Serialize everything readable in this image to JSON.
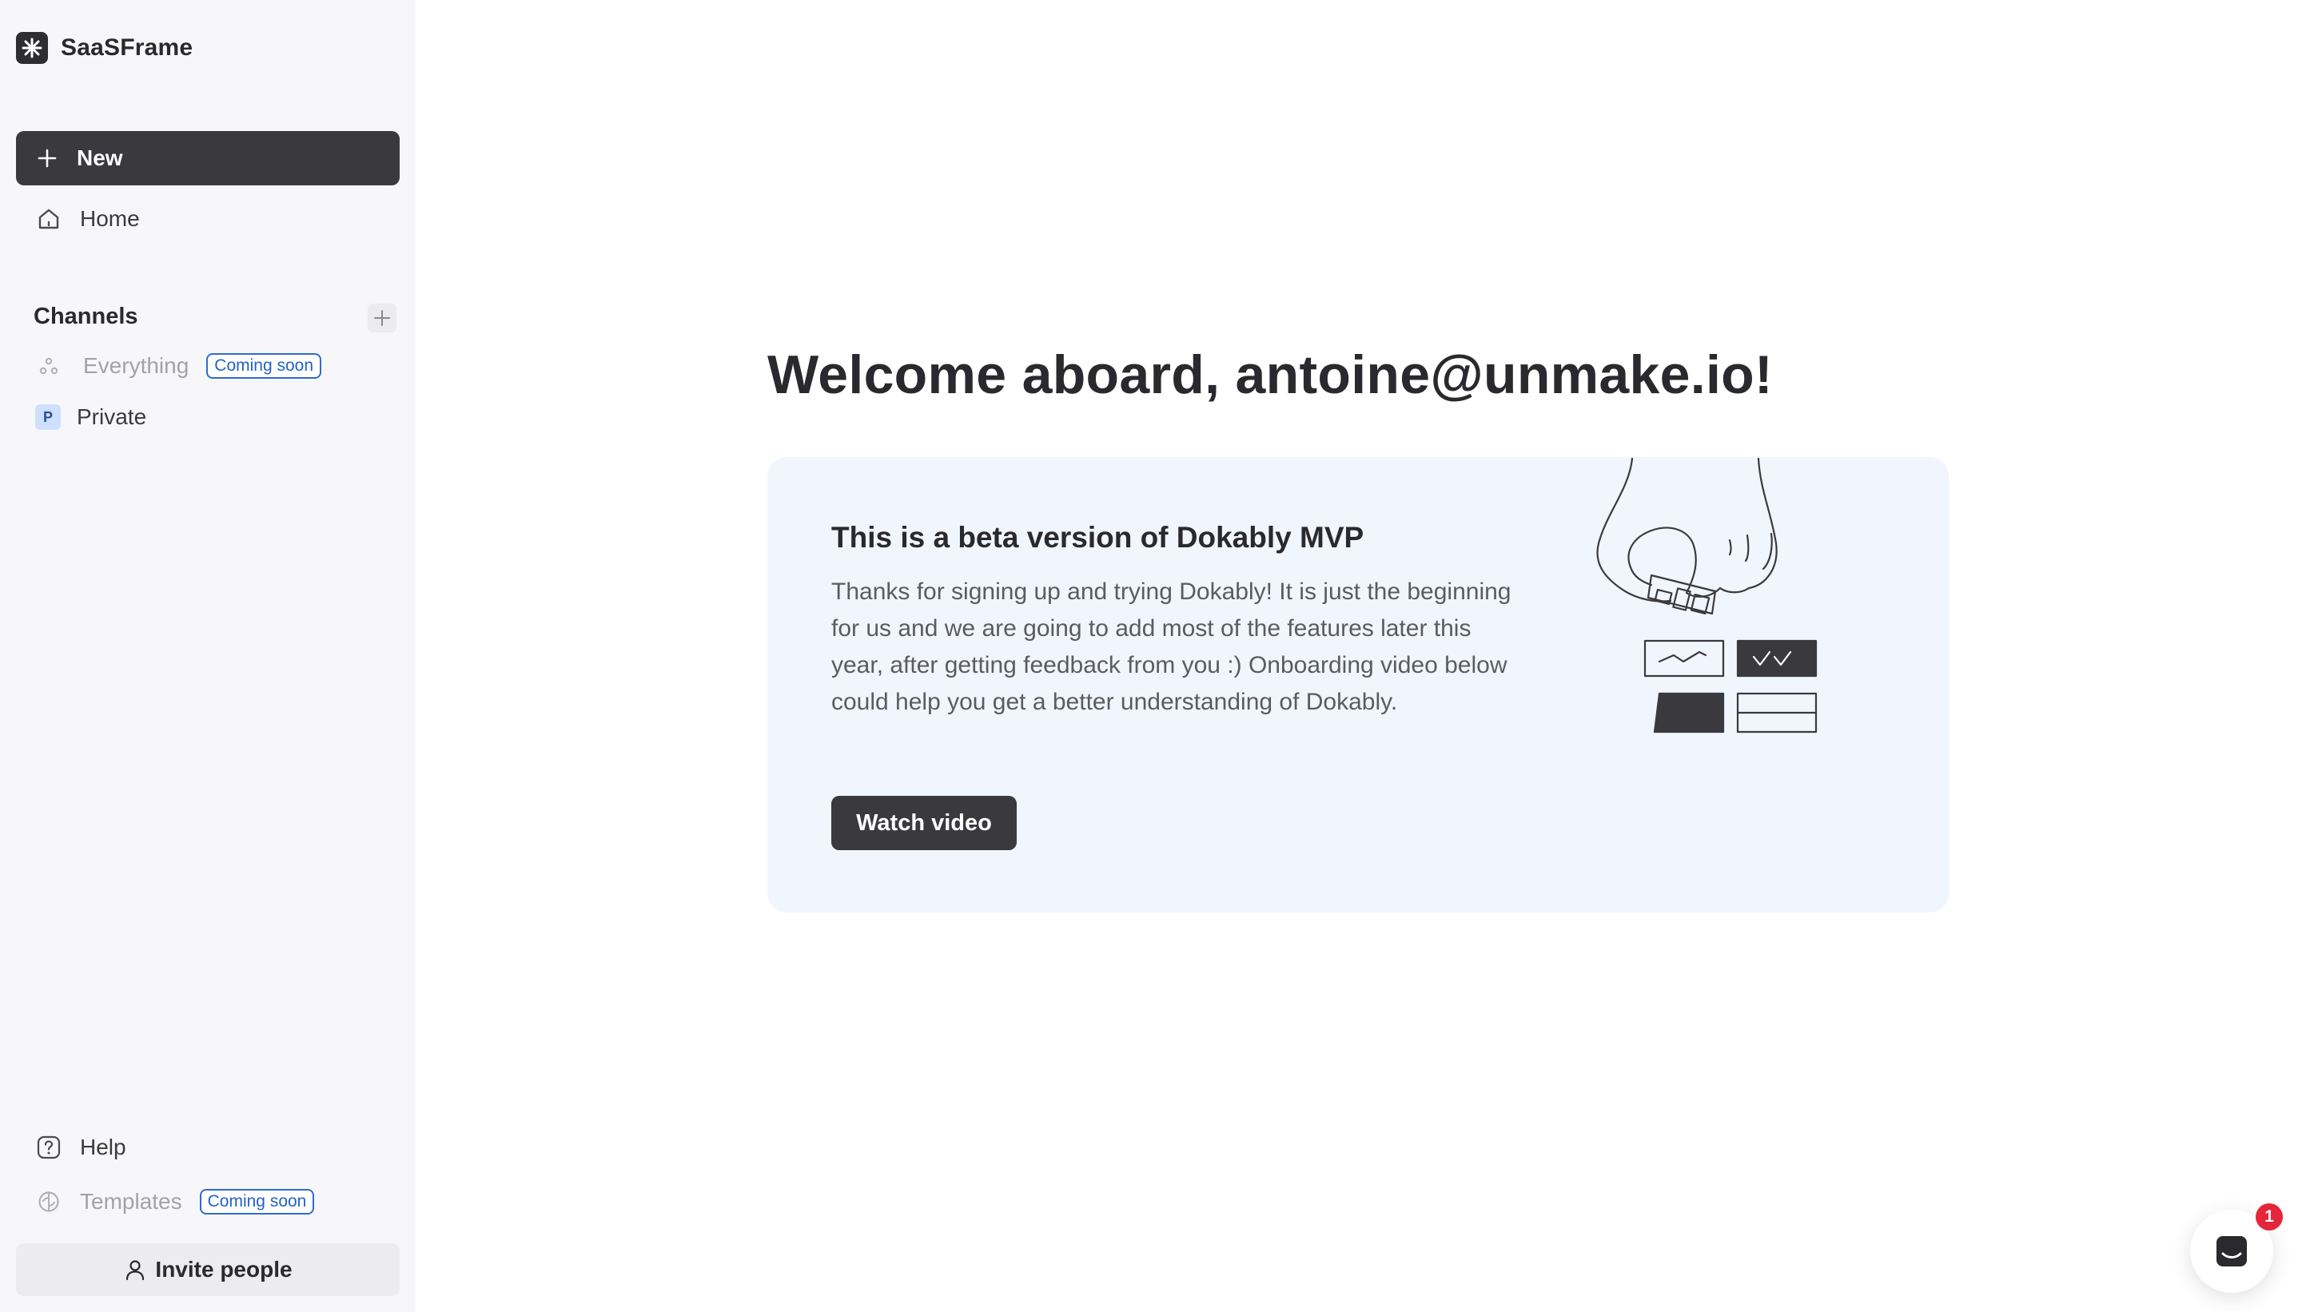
{
  "app": {
    "name": "SaaSFrame"
  },
  "sidebar": {
    "new_label": "New",
    "home_label": "Home",
    "channels_title": "Channels",
    "channels": [
      {
        "label": "Everything",
        "badge": "Coming soon",
        "disabled": true
      },
      {
        "label": "Private",
        "avatar_letter": "P",
        "disabled": false
      }
    ],
    "help_label": "Help",
    "templates_label": "Templates",
    "templates_badge": "Coming soon",
    "invite_label": "Invite people"
  },
  "main": {
    "welcome": "Welcome aboard, antoine@unmake.io!",
    "card": {
      "title": "This is a beta version of Dokably MVP",
      "body": "Thanks for signing up and trying Dokably! It is just the beginning for us and we are going to add most of the features later this year, after getting feedback from you :) Onboarding video below could help you get a better understanding of Dokably.",
      "button_label": "Watch video"
    }
  },
  "chat": {
    "unread_count": "1"
  },
  "colors": {
    "sidebar_bg": "#f7f7f9",
    "primary_dark": "#3a3a3e",
    "card_bg": "#f1f5fd",
    "badge_blue": "#2f6bd0",
    "notification_red": "#e5263a"
  }
}
